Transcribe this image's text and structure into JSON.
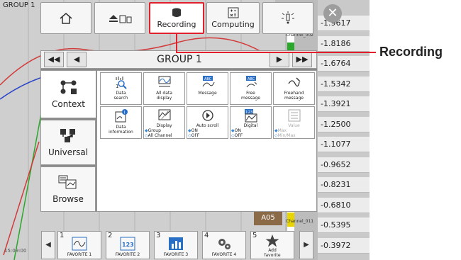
{
  "screen": {
    "group_tag": "GROUP 1",
    "scale_values": [
      "-1.9617",
      "-1.8186",
      "-1.6764",
      "-1.5342",
      "-1.3921",
      "-1.2500",
      "-1.1077",
      "-0.9652",
      "-0.8231",
      "-0.6810",
      "-0.5395",
      "-0.3972"
    ],
    "channel_labels": [
      "Channel_002",
      "Channel_011"
    ],
    "alarm_tag": "A05",
    "time_label": "15:09:00"
  },
  "toolbar": {
    "buttons": [
      {
        "label": "",
        "icon": "home-icon"
      },
      {
        "label": "",
        "icon": "eject-memory-icon"
      },
      {
        "label": "Recording",
        "icon": "database-icon",
        "active": true
      },
      {
        "label": "Computing",
        "icon": "calculator-icon"
      },
      {
        "label": "",
        "icon": "alert-icon"
      }
    ]
  },
  "panel": {
    "title": "GROUP 1",
    "categories": [
      {
        "label": "Context",
        "icon": "context-icon"
      },
      {
        "label": "Universal",
        "icon": "universal-icon"
      },
      {
        "label": "Browse",
        "icon": "browse-icon"
      }
    ],
    "functions": [
      {
        "label": "Data\nsearch",
        "icon": "data-search-icon"
      },
      {
        "label": "All data\ndisplay",
        "icon": "all-data-icon"
      },
      {
        "label": "Message",
        "icon": "message-icon"
      },
      {
        "label": "Free\nmessage",
        "icon": "free-message-icon"
      },
      {
        "label": "Freehand\nmessage",
        "icon": "freehand-icon"
      },
      {
        "label": "Data\ninformation",
        "icon": "data-info-icon"
      },
      {
        "label": "Display",
        "icon": "display-icon",
        "opts": [
          "Group",
          "All Channel"
        ]
      },
      {
        "label": "Auto scroll",
        "icon": "auto-scroll-icon",
        "opts": [
          "ON",
          "OFF"
        ]
      },
      {
        "label": "Digital",
        "icon": "digital-icon",
        "opts": [
          "ON",
          "OFF"
        ]
      },
      {
        "label": "Value",
        "icon": "value-icon",
        "opts": [
          "Max",
          "Min/Max"
        ],
        "disabled": true
      }
    ]
  },
  "favorites": [
    {
      "num": "1",
      "label": "FAVORITE 1",
      "icon": "waveform-icon"
    },
    {
      "num": "2",
      "label": "FAVORITE 2",
      "icon": "digital-123-icon"
    },
    {
      "num": "3",
      "label": "FAVORITE 3",
      "icon": "bar-chart-icon"
    },
    {
      "num": "4",
      "label": "FAVORITE 4",
      "icon": "gears-icon"
    },
    {
      "num": "5",
      "label": "Add\nfavorite",
      "icon": "star-icon"
    }
  ],
  "callout": {
    "label": "Recording",
    "color": "#e0202a"
  },
  "colors": {
    "accent": "#e0202a",
    "highlight": "#3a8ad8"
  }
}
